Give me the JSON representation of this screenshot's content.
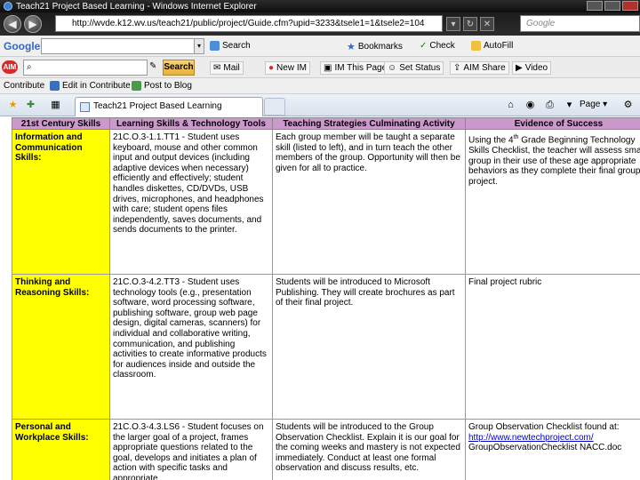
{
  "window": {
    "title": "Teach21 Project Based Learning - Windows Internet Explorer"
  },
  "address_bar": {
    "url": "http://wvde.k12.wv.us/teach21/public/project/Guide.cfm?upid=3233&tsele1=1&tsele2=104",
    "search_placeholder": "Google"
  },
  "google_toolbar": {
    "logo": "Google",
    "items": [
      {
        "label": "Search",
        "icon": "search-icon"
      },
      {
        "label": "Bookmarks",
        "icon": "star-icon"
      },
      {
        "label": "Check",
        "icon": "abc-check-icon"
      },
      {
        "label": "AutoFill",
        "icon": "autofill-icon"
      }
    ]
  },
  "aim_toolbar": {
    "logo": "AIM",
    "search_value": "",
    "search_button": "Search",
    "items": [
      {
        "label": "Mail",
        "icon": "mail-icon"
      },
      {
        "label": "New IM",
        "icon": "new-im-icon"
      },
      {
        "label": "IM This Page",
        "icon": "im-page-icon"
      },
      {
        "label": "Set Status",
        "icon": "status-icon"
      },
      {
        "label": "AIM Share",
        "icon": "share-icon"
      },
      {
        "label": "Video",
        "icon": "video-icon"
      }
    ]
  },
  "contribute_bar": {
    "items": [
      {
        "label": "Contribute"
      },
      {
        "label": "Edit in Contribute"
      },
      {
        "label": "Post to Blog"
      }
    ]
  },
  "tab_bar": {
    "active_tab": "Teach21 Project Based Learning",
    "page_menu": "Page"
  },
  "table": {
    "headers": [
      "21st Century Skills",
      "Learning Skills & Technology Tools",
      "Teaching Strategies Culminating Activity",
      "Evidence of Success"
    ],
    "rows": [
      {
        "skill": "Information and Communication Skills:",
        "tools": "21C.O.3-1.1.TT1 - Student uses keyboard, mouse and other common input and output devices (including adaptive devices when necessary) efficiently and effectively; student handles diskettes, CD/DVDs, USB drives, microphones, and headphones with care; student opens files independently, saves documents, and sends documents to the printer.",
        "strategies": "Each group member will be taught a separate skill (listed to left), and in turn teach the other members of the group. Opportunity will then be given for all to practice.",
        "evidence_pre": "Using the 4",
        "evidence_sup": "th",
        "evidence_post": " Grade Beginning Technology Skills Checklist, the teacher will assess small group in their use of these age appropriate behaviors as they complete their final group project."
      },
      {
        "skill": "Thinking and Reasoning Skills:",
        "tools": "21C.O.3-4.2.TT3 - Student uses technology tools (e.g., presentation software, word processing software, publishing software, group web page design, digital cameras, scanners) for individual and collaborative writing, communication, and publishing activities to create informative products for audiences inside and outside the classroom.",
        "strategies": "Students will be introduced to Microsoft Publishing. They will create brochures as part of their final project.",
        "evidence": "Final project rubric"
      },
      {
        "skill": "Personal and Workplace Skills:",
        "tools": "21C.O.3-4.3.LS6 - Student focuses on the larger goal of a project, frames appropriate questions related to the goal, develops and initiates a plan of action with specific tasks and appropriate",
        "strategies": "Students will be introduced to the Group Observation Checklist. Explain it is our goal for the coming weeks and mastery is not expected immediately. Conduct at least one formal observation and discuss results, etc.",
        "evidence_line1": "Group Observation Checklist found at:",
        "evidence_link": "http://www.newtechproject.com/",
        "evidence_line3": "GroupObservationChecklist NACC.doc"
      }
    ]
  },
  "colors": {
    "header_purple": "#cc99cc",
    "skill_yellow": "#ffff00",
    "titlebar_dark": "#1a1a1a"
  }
}
